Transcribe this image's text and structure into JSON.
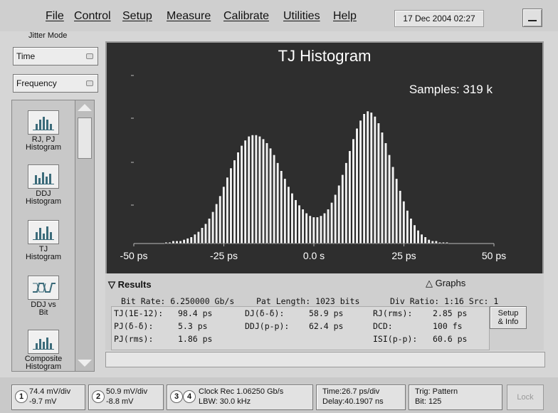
{
  "menu": {
    "items": [
      "File",
      "Control",
      "Setup",
      "Measure",
      "Calibrate",
      "Utilities",
      "Help"
    ]
  },
  "datetime": "17 Dec 2004   02:27",
  "left_panel": {
    "jitter_mode_label": "Jitter Mode",
    "mode_select": "Time",
    "domain_select": "Frequency",
    "tools": [
      {
        "line1": "RJ, PJ",
        "line2": "Histogram"
      },
      {
        "line1": "DDJ",
        "line2": "Histogram"
      },
      {
        "line1": "TJ",
        "line2": "Histogram"
      },
      {
        "line1": "DDJ vs",
        "line2": "Bit"
      },
      {
        "line1": "Composite",
        "line2": "Histogram"
      }
    ]
  },
  "chart_data": {
    "type": "bar",
    "title": "TJ Histogram",
    "annotation": "Samples: 319 k",
    "x_tick_labels": [
      "-50 ps",
      "-25 ps",
      "0.0 s",
      "25 ps",
      "50 ps"
    ],
    "xlim": [
      -50,
      50
    ],
    "x_unit": "ps",
    "grid": false,
    "legend": "none",
    "bin_width_ps": 1,
    "relative_counts": [
      0.01,
      0.01,
      0.02,
      0.02,
      0.02,
      0.03,
      0.04,
      0.05,
      0.07,
      0.09,
      0.12,
      0.15,
      0.19,
      0.24,
      0.3,
      0.36,
      0.43,
      0.5,
      0.57,
      0.63,
      0.69,
      0.74,
      0.78,
      0.81,
      0.82,
      0.82,
      0.81,
      0.79,
      0.76,
      0.72,
      0.67,
      0.61,
      0.55,
      0.49,
      0.43,
      0.38,
      0.33,
      0.29,
      0.26,
      0.23,
      0.21,
      0.2,
      0.2,
      0.21,
      0.23,
      0.26,
      0.31,
      0.37,
      0.44,
      0.52,
      0.61,
      0.7,
      0.79,
      0.87,
      0.93,
      0.98,
      1.0,
      0.99,
      0.96,
      0.91,
      0.84,
      0.76,
      0.67,
      0.58,
      0.49,
      0.4,
      0.32,
      0.25,
      0.19,
      0.14,
      0.1,
      0.07,
      0.05,
      0.03,
      0.02,
      0.02,
      0.01,
      0.01,
      0.01
    ],
    "first_bin_ps": -41
  },
  "results": {
    "tab_label": "Results",
    "graphs_label": "Graphs",
    "bit_rate": "Bit Rate: 6.250000 Gb/s",
    "pat_length": "Pat Length: 1023 bits",
    "div_ratio": "Div Ratio: 1:16 Src: 1",
    "rows": [
      [
        "TJ(1E-12):",
        "98.4 ps",
        "DJ(δ-δ):",
        "58.9 ps",
        "RJ(rms):",
        "2.85 ps"
      ],
      [
        "PJ(δ-δ):",
        "5.3 ps",
        "DDJ(p-p):",
        "62.4 ps",
        "DCD:",
        "100 fs"
      ],
      [
        "PJ(rms):",
        "1.86 ps",
        "",
        "",
        "ISI(p-p):",
        "60.6 ps"
      ]
    ],
    "setup_button": {
      "line1": "Setup",
      "line2": "& Info"
    }
  },
  "bottom_bar": {
    "channels": [
      {
        "num": "1",
        "line1": "74.4 mV/div",
        "line2": "-9.7 mV"
      },
      {
        "num": "2",
        "line1": "50.9 mV/div",
        "line2": "-8.8 mV"
      },
      {
        "num": "3",
        "num2": "4",
        "line1": "Clock Rec 1.06250 Gb/s",
        "line2": "LBW: 30.0 kHz"
      },
      {
        "num": "",
        "line1": "Time:26.7 ps/div",
        "line2": "Delay:40.1907 ns"
      },
      {
        "num": "",
        "line1": "Trig: Pattern",
        "line2": "Bit: 125"
      }
    ],
    "lock_label": "Lock"
  },
  "colors": {
    "plot_bg": "#2e2e2e",
    "bar_fill": "#f2f2f2",
    "chrome": "#d6d6d6"
  }
}
